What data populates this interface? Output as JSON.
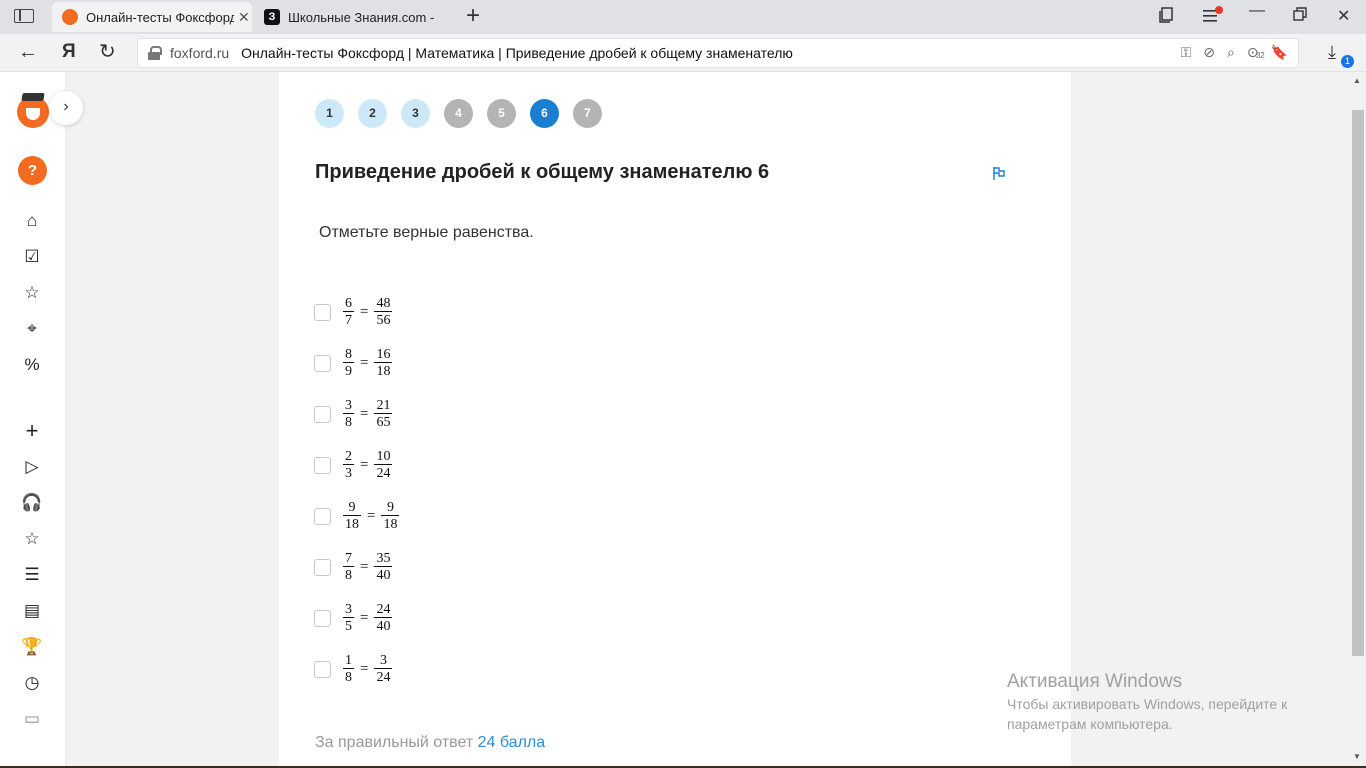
{
  "browser": {
    "tabs": [
      {
        "title": "Онлайн-тесты Фоксфорд",
        "active": true,
        "icon": "foxford-favicon"
      },
      {
        "title": "Школьные Знания.com - Р",
        "active": false,
        "icon": "znanija-favicon",
        "glyph": "З"
      }
    ],
    "address": {
      "domain": "foxford.ru",
      "page_title": "Онлайн-тесты Фоксфорд | Математика | Приведение дробей к общему знаменателю"
    },
    "downloads_badge": "1",
    "counter_badge": "32"
  },
  "sidebar": {
    "orange_button_glyph": "?",
    "icons": [
      "home-icon",
      "checklist-icon",
      "star-icon",
      "tag-icon",
      "percent-icon",
      "plus-icon",
      "play-icon",
      "headphones-icon",
      "star-icon",
      "list-icon",
      "stack-icon",
      "trophy-icon",
      "clock-icon",
      "briefcase-icon"
    ]
  },
  "quiz": {
    "steps": [
      {
        "label": "1",
        "state": "done"
      },
      {
        "label": "2",
        "state": "done"
      },
      {
        "label": "3",
        "state": "done"
      },
      {
        "label": "4",
        "state": "pending"
      },
      {
        "label": "5",
        "state": "pending"
      },
      {
        "label": "6",
        "state": "current"
      },
      {
        "label": "7",
        "state": "pending"
      }
    ],
    "title": "Приведение дробей к общему знаменателю 6",
    "instruction": "Отметьте верные равенства.",
    "options": [
      {
        "a_num": "6",
        "a_den": "7",
        "b_num": "48",
        "b_den": "56"
      },
      {
        "a_num": "8",
        "a_den": "9",
        "b_num": "16",
        "b_den": "18"
      },
      {
        "a_num": "3",
        "a_den": "8",
        "b_num": "21",
        "b_den": "65"
      },
      {
        "a_num": "2",
        "a_den": "3",
        "b_num": "10",
        "b_den": "24"
      },
      {
        "a_num": "9",
        "a_den": "18",
        "b_num": "9",
        "b_den": "18"
      },
      {
        "a_num": "7",
        "a_den": "8",
        "b_num": "35",
        "b_den": "40"
      },
      {
        "a_num": "3",
        "a_den": "5",
        "b_num": "24",
        "b_den": "40"
      },
      {
        "a_num": "1",
        "a_den": "8",
        "b_num": "3",
        "b_den": "24"
      }
    ],
    "equals_sign": "=",
    "score_label": "За правильный ответ",
    "score_value": "24 балла"
  },
  "watermark": {
    "title": "Активация Windows",
    "line1": "Чтобы активировать Windows, перейдите к",
    "line2": "параметрам компьютера."
  },
  "colors": {
    "accent_blue": "#1a7fd0",
    "brand_orange": "#f26b21",
    "step_done": "#cde9f9",
    "step_pending": "#b4b4b4"
  }
}
